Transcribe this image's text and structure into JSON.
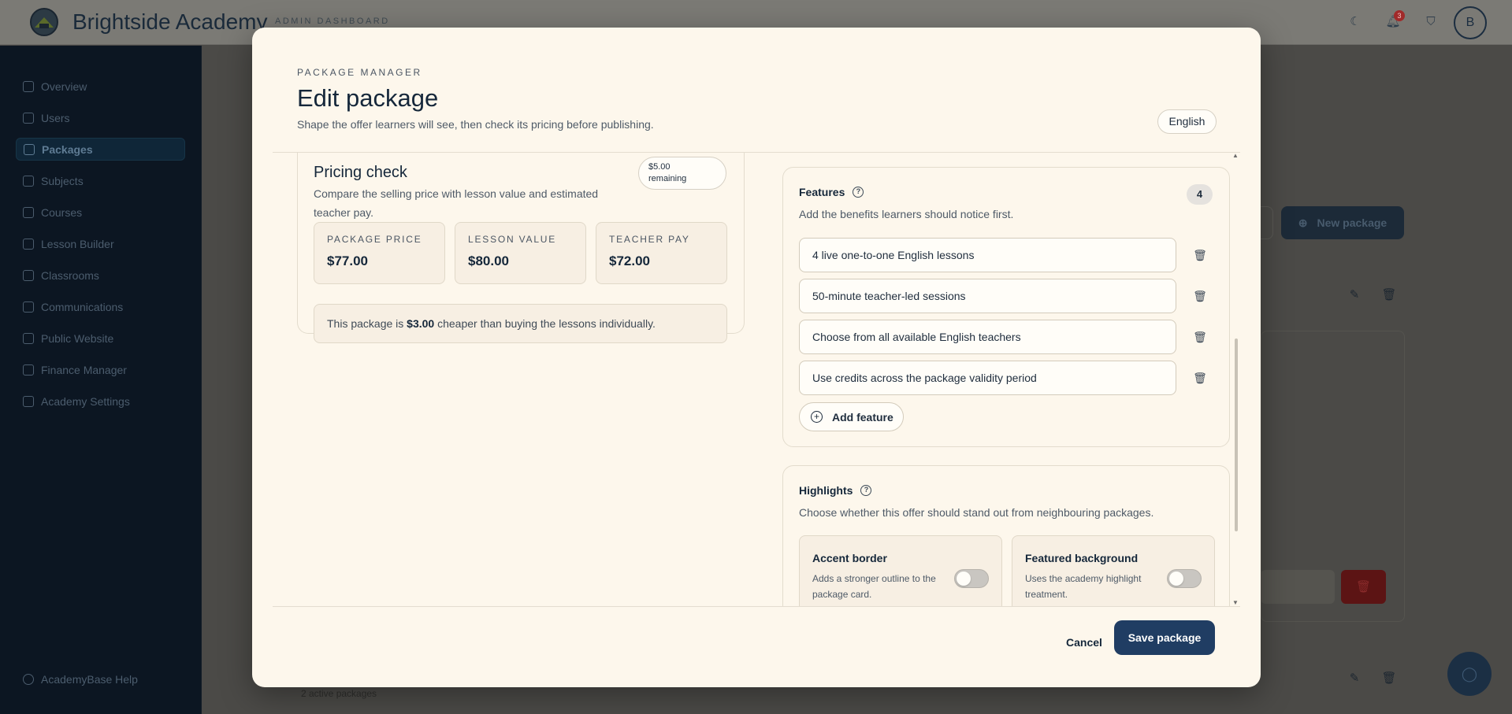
{
  "app": {
    "brand_name": "Brightside Academy",
    "brand_tag": "ADMIN DASHBOARD",
    "notification_count": "3",
    "avatar_initial": "B"
  },
  "sidebar": {
    "items": [
      {
        "label": "Overview",
        "icon": "grid-icon"
      },
      {
        "label": "Users",
        "icon": "users-icon"
      },
      {
        "label": "Packages",
        "icon": "package-icon",
        "active": true
      },
      {
        "label": "Subjects",
        "icon": "book-icon"
      },
      {
        "label": "Courses",
        "icon": "book-open-icon"
      },
      {
        "label": "Lesson Builder",
        "icon": "wand-icon"
      },
      {
        "label": "Classrooms",
        "icon": "classroom-icon"
      },
      {
        "label": "Communications",
        "icon": "chat-icon"
      },
      {
        "label": "Public Website",
        "icon": "globe-icon"
      },
      {
        "label": "Finance Manager",
        "icon": "wallet-icon"
      },
      {
        "label": "Academy Settings",
        "icon": "gear-icon"
      }
    ],
    "help_label": "AcademyBase Help"
  },
  "background": {
    "new_package_label": "New package",
    "package_count_text": "2 active packages"
  },
  "modal": {
    "eyebrow": "PACKAGE MANAGER",
    "title": "Edit package",
    "subtitle": "Shape the offer learners will see, then check its pricing before publishing.",
    "language": "English",
    "pricing": {
      "title": "Pricing check",
      "description": "Compare the selling price with lesson value and estimated teacher pay.",
      "remaining_amount": "$5.00",
      "remaining_label": "remaining",
      "stats": [
        {
          "label": "PACKAGE PRICE",
          "value": "$77.00"
        },
        {
          "label": "LESSON VALUE",
          "value": "$80.00"
        },
        {
          "label": "TEACHER PAY",
          "value": "$72.00"
        }
      ],
      "saving_prefix": "This package is ",
      "saving_amount": "$3.00",
      "saving_suffix": " cheaper than buying the lessons individually."
    },
    "features": {
      "title": "Features",
      "description": "Add the benefits learners should notice first.",
      "count": "4",
      "items": [
        "4 live one-to-one English lessons",
        "50-minute teacher-led sessions",
        "Choose from all available English teachers",
        "Use credits across the package validity period"
      ],
      "add_label": "Add feature"
    },
    "highlights": {
      "title": "Highlights",
      "description": "Choose whether this offer should stand out from neighbouring packages.",
      "options": [
        {
          "title": "Accent border",
          "description": "Adds a stronger outline to the package card.",
          "enabled": false
        },
        {
          "title": "Featured background",
          "description": "Uses the academy highlight treatment.",
          "enabled": false
        }
      ]
    },
    "cancel_label": "Cancel",
    "save_label": "Save package"
  },
  "colors": {
    "primary": "#203d63",
    "modal_bg": "#fdf7ec",
    "sidebar_bg": "#0c1622"
  }
}
